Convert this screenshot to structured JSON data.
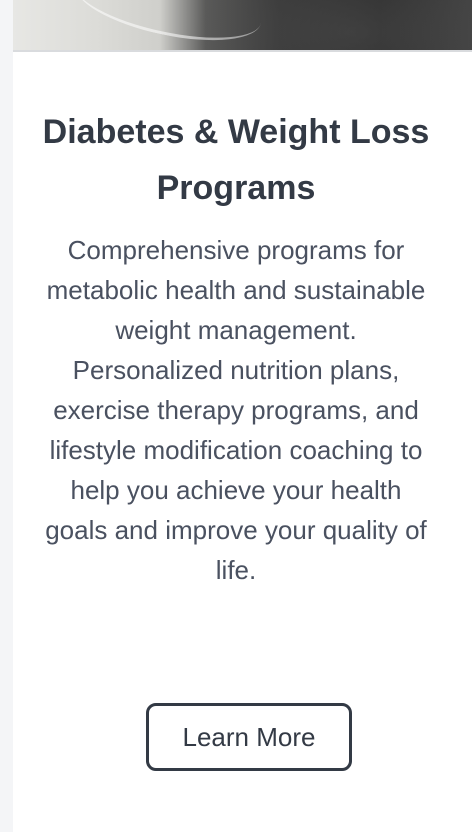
{
  "card": {
    "title": "Diabetes & Weight Loss Programs",
    "description": "Comprehensive programs for metabolic health and sustainable weight management. Personalized nutrition plans, exercise therapy programs, and lifestyle modification coaching to help you achieve your health goals and improve your quality of life.",
    "button_label": "Learn More"
  }
}
